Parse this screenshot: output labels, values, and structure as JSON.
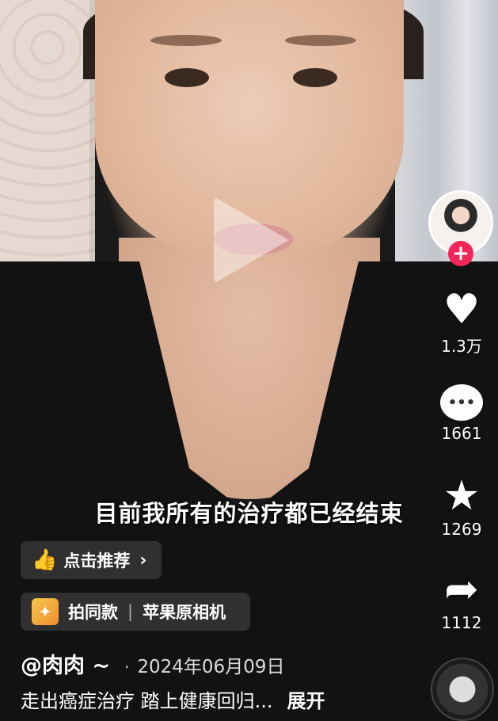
{
  "video": {
    "subtitle": "目前我所有的治疗都已经结束"
  },
  "recommend": {
    "label": "点击推荐",
    "thumb_icon": "thumbs-up-icon",
    "chevron_icon": "chevron-right-icon"
  },
  "same_style": {
    "label": "拍同款",
    "separator": "|",
    "camera": "苹果原相机",
    "icon": "sparkle-icon"
  },
  "post": {
    "author": "@肉肉 ~",
    "dot": "·",
    "date": "2024年06月09日",
    "description": "走出癌症治疗 踏上健康回归...",
    "expand": "展开"
  },
  "actions": {
    "likes": "1.3万",
    "comments": "1661",
    "favorites": "1269",
    "shares": "1112"
  },
  "colors": {
    "follow_badge": "#f3265a",
    "same_style_icon": "#f6c84c"
  }
}
